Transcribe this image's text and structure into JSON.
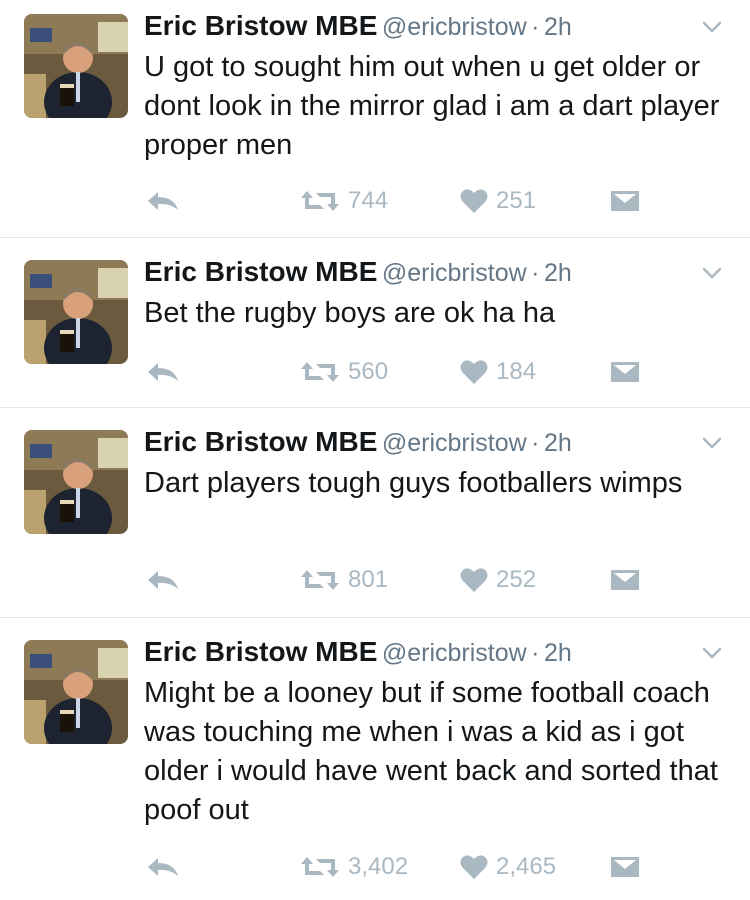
{
  "tweets": [
    {
      "author": {
        "name": "Eric Bristow MBE",
        "handle": "@ericbristow"
      },
      "separator": "·",
      "time": "2h",
      "text": "U got to sought him out when u get older or dont look in the mirror glad i am a dart player proper men",
      "retweets": "744",
      "likes": "251"
    },
    {
      "author": {
        "name": "Eric Bristow MBE",
        "handle": "@ericbristow"
      },
      "separator": "·",
      "time": "2h",
      "text": "Bet the rugby boys are ok ha ha",
      "retweets": "560",
      "likes": "184"
    },
    {
      "author": {
        "name": "Eric Bristow MBE",
        "handle": "@ericbristow"
      },
      "separator": "·",
      "time": "2h",
      "text": "Dart players tough guys footballers wimps",
      "retweets": "801",
      "likes": "252"
    },
    {
      "author": {
        "name": "Eric Bristow MBE",
        "handle": "@ericbristow"
      },
      "separator": "·",
      "time": "2h",
      "text": "Might be a looney but if some football coach was touching me when i was a kid as i got older i would have went back and sorted that poof out",
      "retweets": "3,402",
      "likes": "2,465"
    }
  ],
  "icons": {
    "reply": "reply-icon",
    "retweet": "retweet-icon",
    "like": "heart-icon",
    "dm": "direct-message-icon",
    "caret": "chevron-down-icon"
  },
  "colors": {
    "action_gray": "#aab8c2",
    "secondary_text": "#657786",
    "divider": "#e1e8ed"
  }
}
